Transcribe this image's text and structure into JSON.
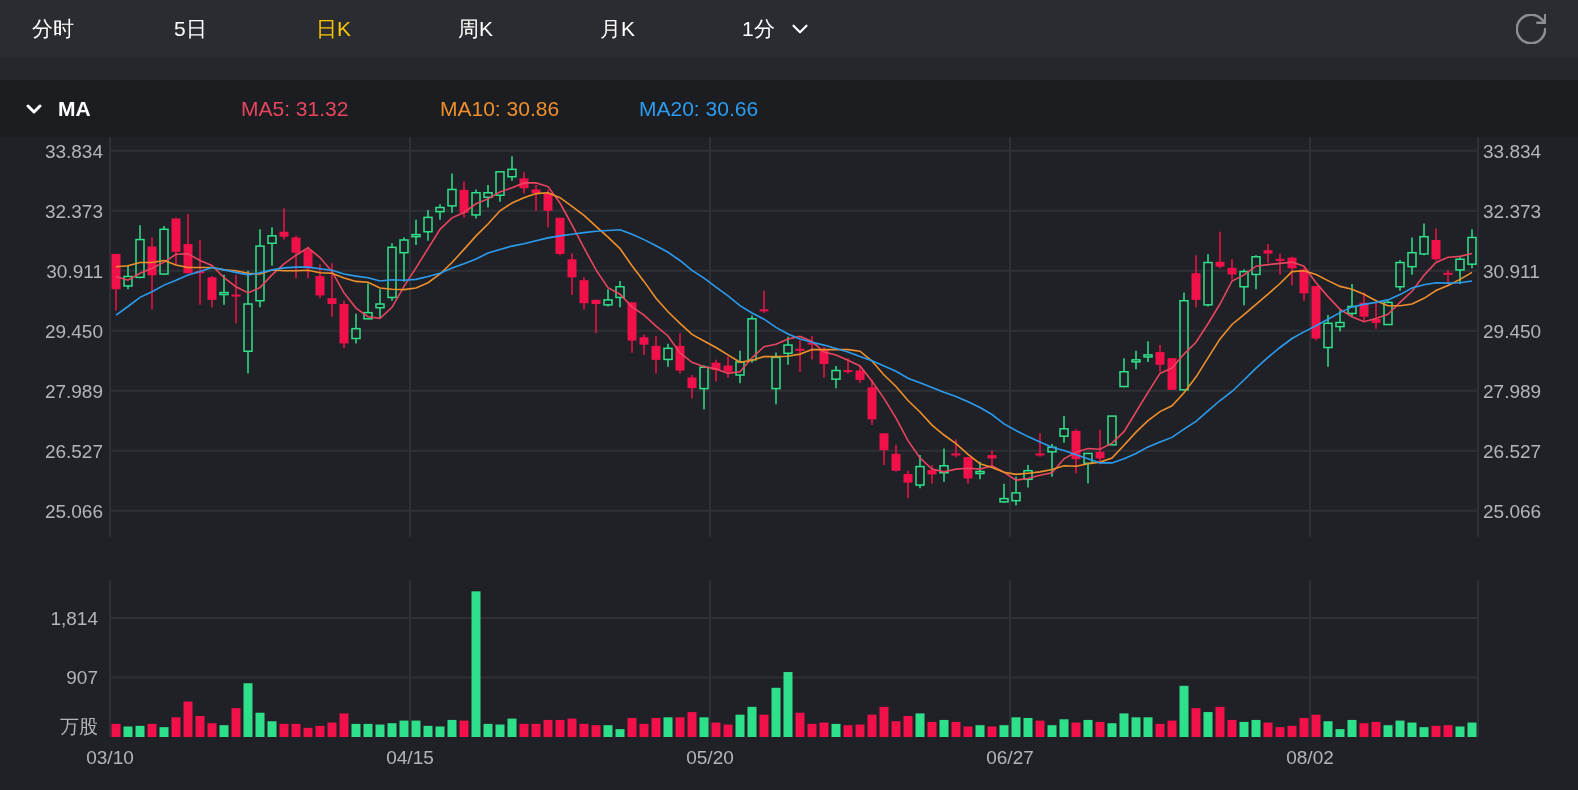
{
  "tabs": [
    {
      "label": "分时",
      "selected": false
    },
    {
      "label": "5日",
      "selected": false
    },
    {
      "label": "日K",
      "selected": true
    },
    {
      "label": "周K",
      "selected": false
    },
    {
      "label": "月K",
      "selected": false
    }
  ],
  "interval_select": {
    "label": "1分"
  },
  "indicator": {
    "label": "MA",
    "expanded": true
  },
  "ma_lines": [
    {
      "label": "MA5: 31.32",
      "color": "#e8455f"
    },
    {
      "label": "MA10: 30.86",
      "color": "#ef8f2c"
    },
    {
      "label": "MA20: 30.66",
      "color": "#2b9cf0"
    }
  ],
  "price_chart": {
    "chart_data": {
      "type": "candlestick",
      "grid": true,
      "ylim": [
        24.425,
        34.168
      ],
      "yticks": [
        {
          "value": 33.834,
          "label": "33.834"
        },
        {
          "value": 32.373,
          "label": "32.373"
        },
        {
          "value": 30.911,
          "label": "30.911"
        },
        {
          "value": 29.45,
          "label": "29.450"
        },
        {
          "value": 27.989,
          "label": "27.989"
        },
        {
          "value": 26.527,
          "label": "26.527"
        },
        {
          "value": 25.066,
          "label": "25.066"
        }
      ],
      "ohlc": [
        [
          31.32,
          31.32,
          29.94,
          30.46
        ],
        [
          30.54,
          31.05,
          30.46,
          30.77
        ],
        [
          30.75,
          32.02,
          30.73,
          31.67
        ],
        [
          31.5,
          31.72,
          29.97,
          30.8
        ],
        [
          30.83,
          32.0,
          30.81,
          31.92
        ],
        [
          32.18,
          32.21,
          31.07,
          31.37
        ],
        [
          31.56,
          32.29,
          30.85,
          30.85
        ],
        [
          30.9,
          31.66,
          30.08,
          30.88
        ],
        [
          30.75,
          30.78,
          30.02,
          30.2
        ],
        [
          30.34,
          30.81,
          30.08,
          30.38
        ],
        [
          30.33,
          30.81,
          29.63,
          30.29
        ],
        [
          28.95,
          30.91,
          28.41,
          30.1
        ],
        [
          30.18,
          31.92,
          30.02,
          31.51
        ],
        [
          31.58,
          31.97,
          31.03,
          31.76
        ],
        [
          31.86,
          32.43,
          31.67,
          31.74
        ],
        [
          31.72,
          31.76,
          30.73,
          31.35
        ],
        [
          31.41,
          31.5,
          30.73,
          30.97
        ],
        [
          30.78,
          31.07,
          30.24,
          30.31
        ],
        [
          30.24,
          31.09,
          29.79,
          30.1
        ],
        [
          30.1,
          30.18,
          29.02,
          29.14
        ],
        [
          29.26,
          29.86,
          29.14,
          29.5
        ],
        [
          29.74,
          30.6,
          29.73,
          29.89
        ],
        [
          30.01,
          30.46,
          29.75,
          30.1
        ],
        [
          30.26,
          31.58,
          30.18,
          31.48
        ],
        [
          31.35,
          31.72,
          30.64,
          31.66
        ],
        [
          31.76,
          32.15,
          31.54,
          31.79
        ],
        [
          31.86,
          32.39,
          31.64,
          32.21
        ],
        [
          32.35,
          32.53,
          32.15,
          32.45
        ],
        [
          32.49,
          33.28,
          32.32,
          32.89
        ],
        [
          32.88,
          33.09,
          32.21,
          32.32
        ],
        [
          32.27,
          32.89,
          32.18,
          32.81
        ],
        [
          32.7,
          33.0,
          32.45,
          32.81
        ],
        [
          32.75,
          33.32,
          32.59,
          33.32
        ],
        [
          33.2,
          33.7,
          33.1,
          33.38
        ],
        [
          33.16,
          33.31,
          32.8,
          32.92
        ],
        [
          32.89,
          33.0,
          32.37,
          32.8
        ],
        [
          32.8,
          32.88,
          31.97,
          32.37
        ],
        [
          32.2,
          32.2,
          31.29,
          31.32
        ],
        [
          31.19,
          31.33,
          30.32,
          30.75
        ],
        [
          30.68,
          30.75,
          29.97,
          30.12
        ],
        [
          30.2,
          30.21,
          29.39,
          30.1
        ],
        [
          30.08,
          30.46,
          30.04,
          30.2
        ],
        [
          30.26,
          30.66,
          30.02,
          30.52
        ],
        [
          30.14,
          30.14,
          28.91,
          29.21
        ],
        [
          29.29,
          29.36,
          28.86,
          29.11
        ],
        [
          29.08,
          29.32,
          28.41,
          28.74
        ],
        [
          28.75,
          29.13,
          28.57,
          29.02
        ],
        [
          29.08,
          29.39,
          28.41,
          28.48
        ],
        [
          28.31,
          28.37,
          27.8,
          28.05
        ],
        [
          28.04,
          28.61,
          27.53,
          28.56
        ],
        [
          28.67,
          28.74,
          28.21,
          28.49
        ],
        [
          28.6,
          28.82,
          28.31,
          28.45
        ],
        [
          28.37,
          28.96,
          28.17,
          28.69
        ],
        [
          28.74,
          29.82,
          28.67,
          29.74
        ],
        [
          29.97,
          30.42,
          29.89,
          29.94
        ],
        [
          28.04,
          28.92,
          27.66,
          28.8
        ],
        [
          28.9,
          29.3,
          28.62,
          29.1
        ],
        [
          29.01,
          29.22,
          28.45,
          28.96
        ],
        [
          29.16,
          29.32,
          28.75,
          29.13
        ],
        [
          28.98,
          29.06,
          28.31,
          28.64
        ],
        [
          28.27,
          28.59,
          28.05,
          28.48
        ],
        [
          28.49,
          28.78,
          28.41,
          28.46
        ],
        [
          28.48,
          28.61,
          28.18,
          28.25
        ],
        [
          28.07,
          28.26,
          27.15,
          27.29
        ],
        [
          26.95,
          26.95,
          26.18,
          26.54
        ],
        [
          26.45,
          26.67,
          26.02,
          26.04
        ],
        [
          25.96,
          26.04,
          25.37,
          25.75
        ],
        [
          25.69,
          26.42,
          25.61,
          26.14
        ],
        [
          26.06,
          26.18,
          25.73,
          25.95
        ],
        [
          25.99,
          26.58,
          25.77,
          26.16
        ],
        [
          26.46,
          26.8,
          26.37,
          26.41
        ],
        [
          26.37,
          26.37,
          25.73,
          25.85
        ],
        [
          25.98,
          26.26,
          25.83,
          26.02
        ],
        [
          26.42,
          26.54,
          26.14,
          26.34
        ],
        [
          25.28,
          25.72,
          25.26,
          25.36
        ],
        [
          25.31,
          25.89,
          25.19,
          25.5
        ],
        [
          25.83,
          26.18,
          25.63,
          26.04
        ],
        [
          26.46,
          26.95,
          26.38,
          26.43
        ],
        [
          26.5,
          26.69,
          25.89,
          26.61
        ],
        [
          26.88,
          27.37,
          26.72,
          27.06
        ],
        [
          27.01,
          27.05,
          25.98,
          26.32
        ],
        [
          26.22,
          26.46,
          25.73,
          26.46
        ],
        [
          26.5,
          27.03,
          26.2,
          26.34
        ],
        [
          26.67,
          27.37,
          26.67,
          27.37
        ],
        [
          28.09,
          28.78,
          28.07,
          28.45
        ],
        [
          28.7,
          28.96,
          28.51,
          28.74
        ],
        [
          28.82,
          29.19,
          28.69,
          28.86
        ],
        [
          28.93,
          29.1,
          28.45,
          28.62
        ],
        [
          28.78,
          28.78,
          28.01,
          28.01
        ],
        [
          28.01,
          30.38,
          27.99,
          30.18
        ],
        [
          30.85,
          31.29,
          30.02,
          30.2
        ],
        [
          30.08,
          31.32,
          30.04,
          31.11
        ],
        [
          31.13,
          31.86,
          30.97,
          31.01
        ],
        [
          30.98,
          31.19,
          30.7,
          30.82
        ],
        [
          30.52,
          30.94,
          30.07,
          30.89
        ],
        [
          30.82,
          31.29,
          30.46,
          31.25
        ],
        [
          31.41,
          31.56,
          31.11,
          31.33
        ],
        [
          31.2,
          31.33,
          30.81,
          31.17
        ],
        [
          31.23,
          31.25,
          30.56,
          30.97
        ],
        [
          30.94,
          30.97,
          30.18,
          30.36
        ],
        [
          30.54,
          30.54,
          29.21,
          29.26
        ],
        [
          29.04,
          29.83,
          28.57,
          29.63
        ],
        [
          29.55,
          29.95,
          29.43,
          29.65
        ],
        [
          29.87,
          30.59,
          29.81,
          30.04
        ],
        [
          30.13,
          30.38,
          29.67,
          29.79
        ],
        [
          29.74,
          30.13,
          29.5,
          29.64
        ],
        [
          29.6,
          30.18,
          29.59,
          30.14
        ],
        [
          30.52,
          31.17,
          30.42,
          31.11
        ],
        [
          31.01,
          31.72,
          30.81,
          31.35
        ],
        [
          31.32,
          32.06,
          31.29,
          31.74
        ],
        [
          31.66,
          31.94,
          31.16,
          31.19
        ],
        [
          30.86,
          30.93,
          30.62,
          30.83
        ],
        [
          30.93,
          31.24,
          30.59,
          31.19
        ],
        [
          31.07,
          31.92,
          30.97,
          31.72
        ]
      ]
    },
    "ma_chart": {
      "chart_data": {
        "type": "line",
        "ylim": [
          24.425,
          34.168
        ],
        "series": [
          {
            "color": "#e8455f",
            "values": [
              30.77,
              30.68,
              30.85,
              30.97,
              31.12,
              31.31,
              31.32,
              31.16,
              31.04,
              30.74,
              30.52,
              30.37,
              30.5,
              30.81,
              31.08,
              31.29,
              31.47,
              31.23,
              30.89,
              30.37,
              30.0,
              29.79,
              29.75,
              30.02,
              30.53,
              30.98,
              31.45,
              31.92,
              32.2,
              32.33,
              32.54,
              32.66,
              32.83,
              32.93,
              33.05,
              33.05,
              32.96,
              32.56,
              32.03,
              31.47,
              30.93,
              30.5,
              30.34,
              30.03,
              29.83,
              29.56,
              29.32,
              28.91,
              28.68,
              28.57,
              28.52,
              28.41,
              28.45,
              28.79,
              29.06,
              29.12,
              29.25,
              29.31,
              29.19,
              28.93,
              28.86,
              28.73,
              28.59,
              28.22,
              27.8,
              27.32,
              26.77,
              26.35,
              26.08,
              26.01,
              26.08,
              26.1,
              26.08,
              26.16,
              26.0,
              25.81,
              25.85,
              25.93,
              25.99,
              26.33,
              26.49,
              26.58,
              26.56,
              26.71,
              26.99,
              27.47,
              27.95,
              28.41,
              28.54,
              28.88,
              29.17,
              29.62,
              30.1,
              30.66,
              30.81,
              31.02,
              31.06,
              31.09,
              31.12,
              31.02,
              30.62,
              30.28,
              29.97,
              29.79,
              29.67,
              29.75,
              29.85,
              30.14,
              30.41,
              30.8,
              31.11,
              31.24,
              31.26,
              31.33
            ]
          },
          {
            "color": "#ef8f2c",
            "values": [
              31.01,
              31.03,
              31.11,
              31.11,
              31.16,
              31.05,
              30.99,
              30.99,
              30.99,
              30.93,
              30.91,
              30.85,
              30.83,
              30.93,
              30.91,
              30.91,
              30.92,
              30.86,
              30.85,
              30.73,
              30.65,
              30.63,
              30.49,
              30.46,
              30.45,
              30.49,
              30.62,
              30.83,
              31.11,
              31.43,
              31.76,
              32.05,
              32.37,
              32.56,
              32.69,
              32.79,
              32.81,
              32.69,
              32.48,
              32.26,
              31.99,
              31.73,
              31.45,
              31.03,
              30.65,
              30.24,
              29.91,
              29.63,
              29.36,
              29.2,
              29.04,
              28.86,
              28.68,
              28.73,
              28.82,
              28.82,
              28.83,
              28.88,
              28.99,
              28.99,
              28.99,
              28.99,
              28.95,
              28.71,
              28.37,
              28.09,
              27.75,
              27.47,
              27.15,
              26.91,
              26.7,
              26.44,
              26.21,
              26.12,
              26.0,
              25.95,
              25.98,
              26.01,
              26.07,
              26.16,
              26.15,
              26.21,
              26.25,
              26.35,
              26.66,
              26.98,
              27.26,
              27.48,
              27.62,
              27.94,
              28.32,
              28.79,
              29.25,
              29.6,
              29.84,
              30.09,
              30.34,
              30.6,
              30.89,
              30.91,
              30.82,
              30.67,
              30.53,
              30.46,
              30.34,
              30.18,
              30.06,
              30.06,
              30.1,
              30.24,
              30.43,
              30.55,
              30.7,
              30.87
            ]
          },
          {
            "color": "#2b9cf0",
            "values": [
              29.83,
              30.04,
              30.26,
              30.4,
              30.56,
              30.68,
              30.81,
              30.89,
              30.99,
              30.93,
              30.87,
              30.81,
              30.86,
              30.93,
              30.98,
              31.0,
              31.0,
              30.96,
              30.92,
              30.83,
              30.78,
              30.74,
              30.66,
              30.69,
              30.68,
              30.7,
              30.77,
              30.85,
              30.98,
              31.08,
              31.2,
              31.34,
              31.43,
              31.51,
              31.57,
              31.64,
              31.71,
              31.76,
              31.8,
              31.84,
              31.87,
              31.89,
              31.91,
              31.8,
              31.67,
              31.52,
              31.36,
              31.16,
              30.92,
              30.73,
              30.51,
              30.3,
              30.06,
              29.88,
              29.73,
              29.53,
              29.37,
              29.25,
              29.17,
              29.1,
              29.02,
              28.93,
              28.82,
              28.72,
              28.59,
              28.46,
              28.29,
              28.18,
              28.07,
              27.95,
              27.85,
              27.72,
              27.58,
              27.41,
              27.18,
              27.02,
              26.87,
              26.74,
              26.61,
              26.53,
              26.43,
              26.33,
              26.23,
              26.23,
              26.33,
              26.46,
              26.62,
              26.74,
              26.85,
              27.05,
              27.24,
              27.5,
              27.75,
              27.97,
              28.25,
              28.54,
              28.8,
              29.04,
              29.26,
              29.42,
              29.57,
              29.73,
              29.89,
              30.03,
              30.09,
              30.14,
              30.2,
              30.33,
              30.49,
              30.57,
              30.62,
              30.61,
              30.62,
              30.66
            ]
          }
        ]
      }
    }
  },
  "volume_chart": {
    "chart_data": {
      "type": "bar",
      "grid": true,
      "ylabel": "万股",
      "ylim": [
        0,
        2393
      ],
      "yticks": [
        {
          "value": 907,
          "label": "907"
        },
        {
          "value": 1814,
          "label": "1,814"
        }
      ],
      "values": [
        200,
        160,
        170,
        200,
        150,
        300,
        540,
        320,
        210,
        180,
        440,
        820,
        370,
        240,
        200,
        200,
        140,
        170,
        220,
        360,
        200,
        200,
        190,
        210,
        250,
        250,
        170,
        160,
        260,
        250,
        2220,
        200,
        190,
        280,
        200,
        200,
        260,
        260,
        280,
        200,
        180,
        180,
        120,
        290,
        200,
        290,
        300,
        300,
        380,
        300,
        220,
        190,
        340,
        460,
        340,
        750,
        990,
        370,
        200,
        220,
        200,
        180,
        190,
        340,
        460,
        240,
        320,
        360,
        230,
        260,
        230,
        160,
        180,
        160,
        180,
        300,
        290,
        250,
        180,
        270,
        220,
        260,
        230,
        210,
        360,
        300,
        300,
        200,
        250,
        780,
        440,
        380,
        460,
        260,
        230,
        260,
        220,
        150,
        170,
        290,
        340,
        240,
        120,
        260,
        210,
        230,
        180,
        250,
        220,
        150,
        170,
        180,
        160,
        220
      ]
    },
    "date_labels": [
      "03/10",
      "04/15",
      "05/20",
      "06/27",
      "08/02"
    ]
  }
}
